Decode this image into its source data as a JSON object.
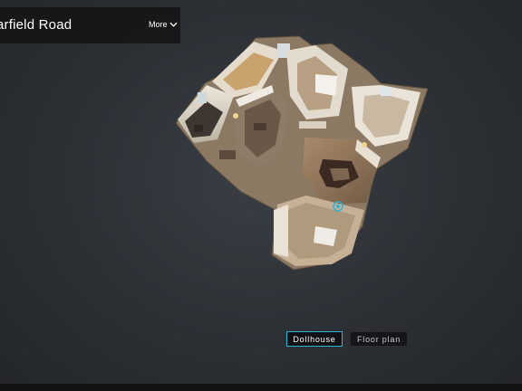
{
  "header": {
    "title": "arfield Road",
    "more_label": "More"
  },
  "view_toggle": {
    "dollhouse_label": "Dollhouse",
    "floorplan_label": "Floor plan",
    "selected": "Dollhouse"
  },
  "colors": {
    "accent": "#2fb3d6",
    "panel": "#141416",
    "background": "#2c3035"
  }
}
